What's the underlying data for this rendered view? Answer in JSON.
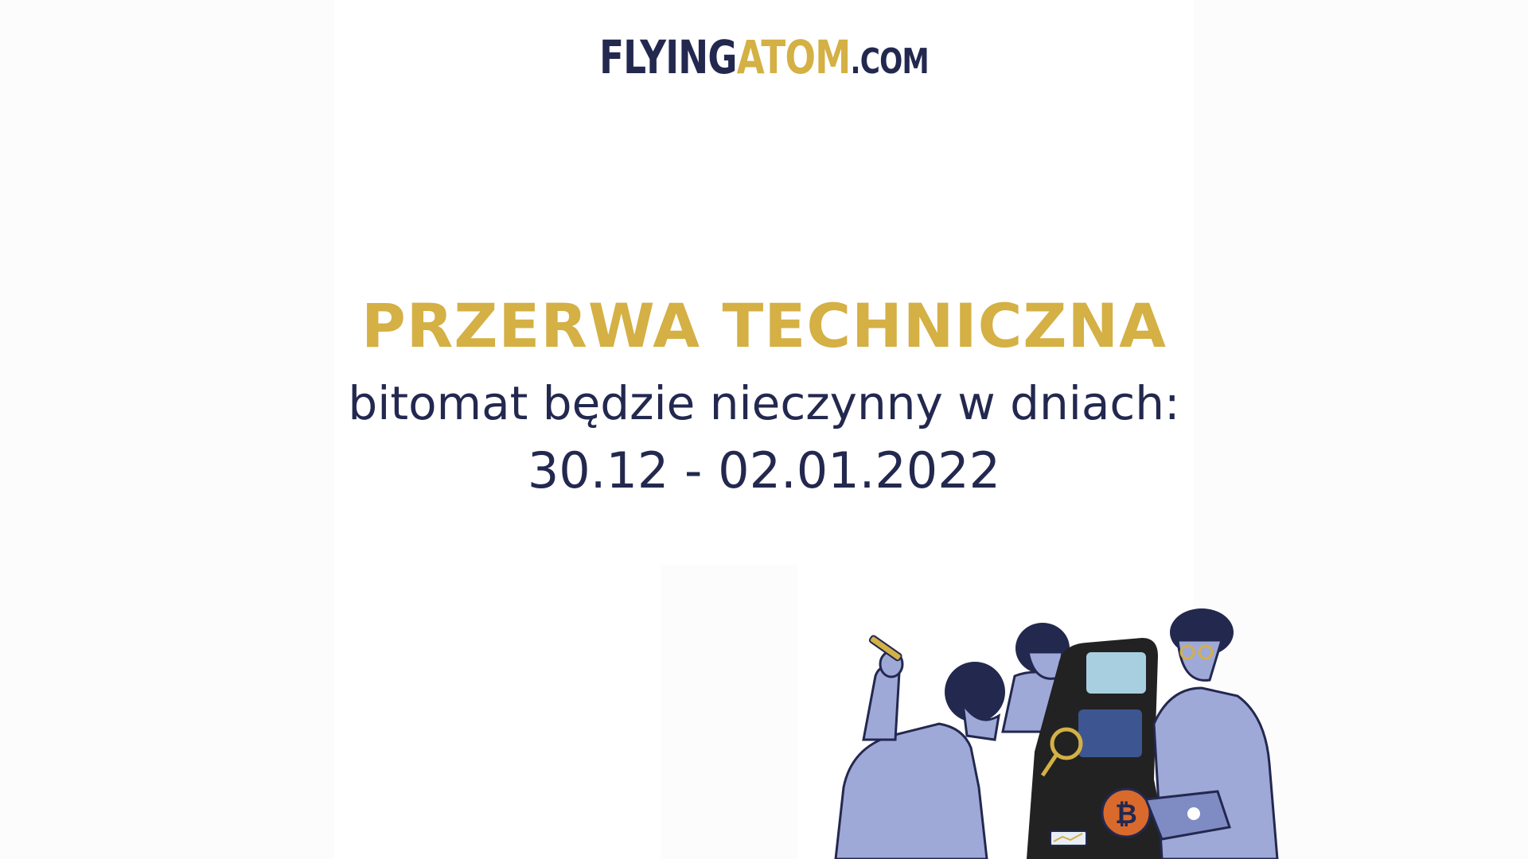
{
  "logo": {
    "part1": "FLYING",
    "part2": "ATOM",
    "part3": ".COM"
  },
  "headline": "PRZERWA TECHNICZNA",
  "subline": "bitomat będzie nieczynny w dniach:",
  "dates": "30.12 - 02.01.2022",
  "colors": {
    "navy": "#23284f",
    "gold": "#d4b045",
    "lavender": "#9fa9d8",
    "dark": "#222222"
  },
  "illustration": {
    "icon": "scientists-repairing-atm-illustration"
  }
}
